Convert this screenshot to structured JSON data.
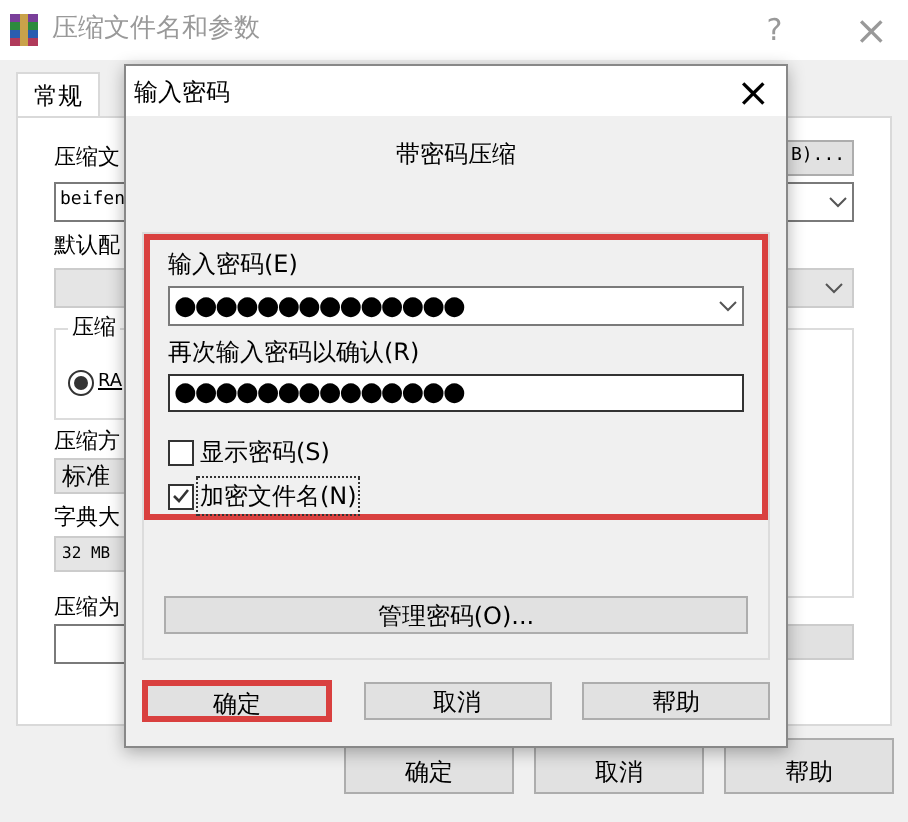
{
  "window": {
    "title": "压缩文件名和参数",
    "help": "?",
    "close": "×"
  },
  "tabs": [
    {
      "label": "常规",
      "selected": true
    }
  ],
  "background": {
    "archive_label": "压缩文",
    "browse_button": "B)...",
    "archive_name": "beifen",
    "profile_label": "默认配",
    "format_group": "压缩",
    "format_radio": {
      "label": "RA",
      "selected": true
    },
    "method_label": "压缩方",
    "method_value": "标准",
    "dict_label": "字典大",
    "dict_value": "32 MB",
    "split_label": "压缩为"
  },
  "buttons": [
    "确定",
    "取消",
    "帮助"
  ],
  "dialog": {
    "title": "输入密码",
    "close": "×",
    "heading": "带密码压缩",
    "password": {
      "label": "输入密码(E)",
      "value": "●●●●●●●●●●●●●●"
    },
    "confirm": {
      "label": "再次输入密码以确认(R)",
      "value": "●●●●●●●●●●●●●●"
    },
    "options": [
      {
        "label": "显示密码(S)",
        "checked": false,
        "focused": false
      },
      {
        "label": "加密文件名(N)",
        "checked": true,
        "focused": true
      }
    ],
    "manage_button": "管理密码(O)...",
    "buttons": [
      {
        "label": "确定",
        "highlighted": true
      },
      {
        "label": "取消",
        "highlighted": false
      },
      {
        "label": "帮助",
        "highlighted": false
      }
    ]
  }
}
